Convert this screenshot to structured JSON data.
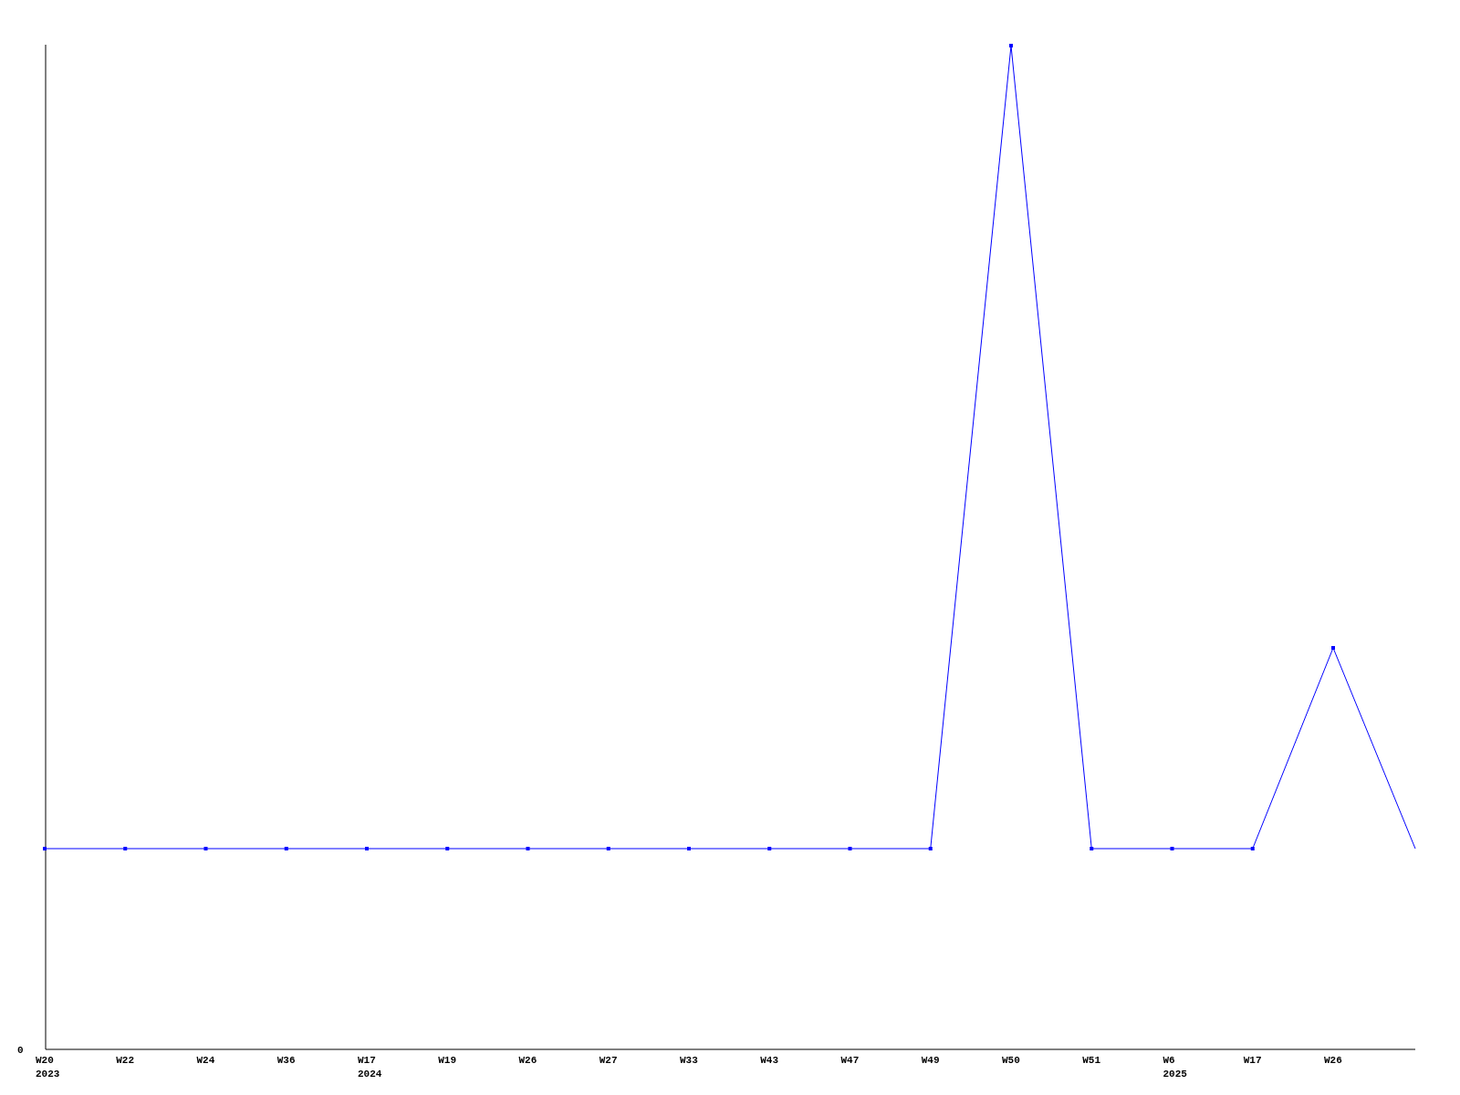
{
  "chart": {
    "y_tick": "0",
    "x_labels": [
      {
        "week": "W20",
        "year": "2023"
      },
      {
        "week": "W22"
      },
      {
        "week": "W24"
      },
      {
        "week": "W36"
      },
      {
        "week": "W17",
        "year": "2024"
      },
      {
        "week": "W19"
      },
      {
        "week": "W26"
      },
      {
        "week": "W27"
      },
      {
        "week": "W33"
      },
      {
        "week": "W43"
      },
      {
        "week": "W47"
      },
      {
        "week": "W49"
      },
      {
        "week": "W50"
      },
      {
        "week": "W51"
      },
      {
        "week": "W6",
        "year": "2025"
      },
      {
        "week": "W17"
      },
      {
        "week": "W26"
      }
    ]
  }
}
